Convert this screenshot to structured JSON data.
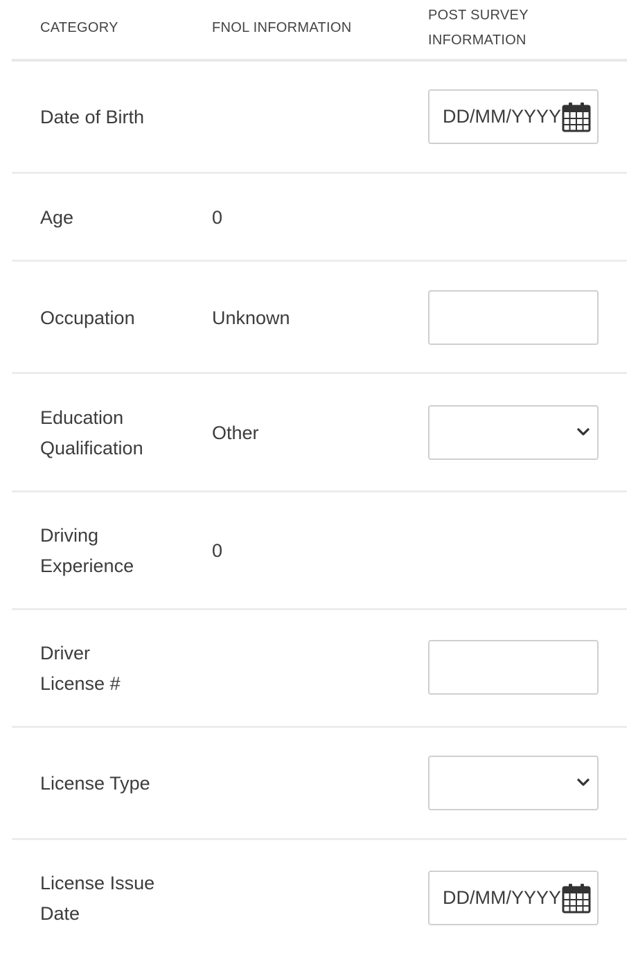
{
  "header": {
    "category": "CATEGORY",
    "fnol": "FNOL INFORMATION",
    "post_survey_line1": "POST SURVEY",
    "post_survey_line2": "INFORMATION"
  },
  "rows": [
    {
      "category": "Date of Birth",
      "fnol": "",
      "control": "date",
      "placeholder": "DD/MM/YYYY"
    },
    {
      "category": "Age",
      "fnol": "0",
      "control": "none"
    },
    {
      "category": "Occupation",
      "fnol": "Unknown",
      "control": "text",
      "value": ""
    },
    {
      "category_line1": "Education",
      "category_line2": "Qualification",
      "fnol": "Other",
      "control": "select",
      "value": ""
    },
    {
      "category_line1": "Driving",
      "category_line2": "Experience",
      "fnol": "0",
      "control": "none"
    },
    {
      "category_line1": "Driver",
      "category_line2": "License #",
      "fnol": "",
      "control": "text",
      "value": ""
    },
    {
      "category": "License Type",
      "fnol": "",
      "control": "select",
      "value": ""
    },
    {
      "category_line1": "License Issue",
      "category_line2": "Date",
      "fnol": "",
      "control": "date",
      "placeholder": "DD/MM/YYYY"
    }
  ],
  "icons": {
    "date": "calendar-icon",
    "select": "chevron-down-icon"
  },
  "colors": {
    "text": "#3c3c3c",
    "border": "#cfcfcf",
    "divider": "#ececec"
  }
}
